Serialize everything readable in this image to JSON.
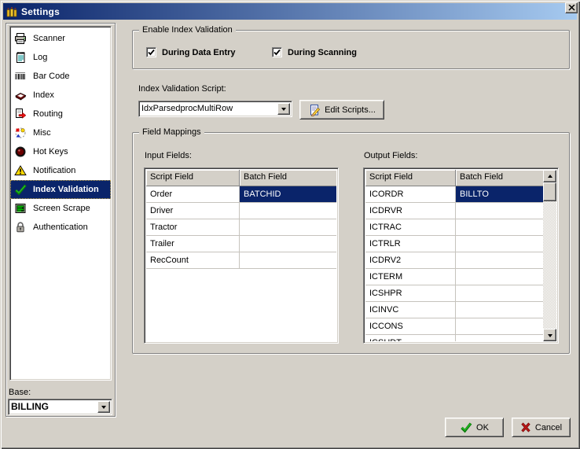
{
  "window": {
    "title": "Settings"
  },
  "sidebar": {
    "items": [
      {
        "label": "Scanner",
        "selected": false
      },
      {
        "label": "Log",
        "selected": false
      },
      {
        "label": "Bar Code",
        "selected": false
      },
      {
        "label": "Index",
        "selected": false
      },
      {
        "label": "Routing",
        "selected": false
      },
      {
        "label": "Misc",
        "selected": false
      },
      {
        "label": "Hot Keys",
        "selected": false
      },
      {
        "label": "Notification",
        "selected": false
      },
      {
        "label": "Index Validation",
        "selected": true
      },
      {
        "label": "Screen Scrape",
        "selected": false
      },
      {
        "label": "Authentication",
        "selected": false
      }
    ],
    "base_label": "Base:",
    "base_value": "BILLING"
  },
  "main": {
    "enable_group": {
      "title": "Enable Index Validation",
      "checkboxes": [
        {
          "label": "During Data Entry",
          "checked": true
        },
        {
          "label": "During Scanning",
          "checked": true
        }
      ]
    },
    "script": {
      "label": "Index Validation Script:",
      "value": "IdxParsedprocMultiRow",
      "edit_button": "Edit Scripts..."
    },
    "field_mappings": {
      "title": "Field Mappings",
      "input": {
        "label": "Input Fields:",
        "columns": [
          "Script Field",
          "Batch Field"
        ],
        "rows": [
          {
            "script": "Order",
            "batch": "BATCHID",
            "selected": true
          },
          {
            "script": "Driver",
            "batch": "",
            "selected": false
          },
          {
            "script": "Tractor",
            "batch": "",
            "selected": false
          },
          {
            "script": "Trailer",
            "batch": "",
            "selected": false
          },
          {
            "script": "RecCount",
            "batch": "",
            "selected": false
          }
        ]
      },
      "output": {
        "label": "Output Fields:",
        "columns": [
          "Script Field",
          "Batch Field"
        ],
        "rows": [
          {
            "script": "ICORDR",
            "batch": "BILLTO",
            "selected": true
          },
          {
            "script": "ICDRVR",
            "batch": "",
            "selected": false
          },
          {
            "script": "ICTRAC",
            "batch": "",
            "selected": false
          },
          {
            "script": "ICTRLR",
            "batch": "",
            "selected": false
          },
          {
            "script": "ICDRV2",
            "batch": "",
            "selected": false
          },
          {
            "script": "ICTERM",
            "batch": "",
            "selected": false
          },
          {
            "script": "ICSHPR",
            "batch": "",
            "selected": false
          },
          {
            "script": "ICINVC",
            "batch": "",
            "selected": false
          },
          {
            "script": "ICCONS",
            "batch": "",
            "selected": false
          },
          {
            "script": "ICSHDT",
            "batch": "",
            "selected": false
          }
        ]
      }
    }
  },
  "footer": {
    "ok": "OK",
    "cancel": "Cancel"
  },
  "colors": {
    "face": "#d4d0c8",
    "selection": "#0a246a",
    "titlebar_start": "#0a246a",
    "titlebar_end": "#a6caf0",
    "ok_check_green": "#009618",
    "cancel_x_red": "#c00000"
  }
}
